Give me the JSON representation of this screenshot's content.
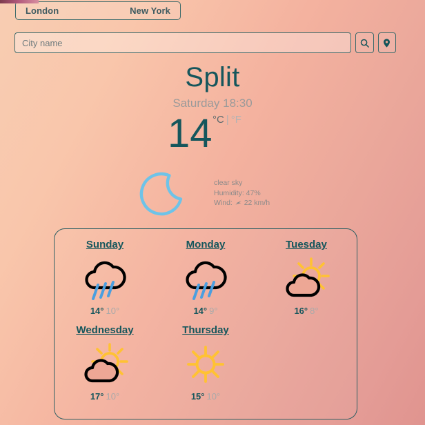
{
  "tabs": [
    {
      "label": "London",
      "name": "tab-london"
    },
    {
      "label": "New York",
      "name": "tab-new-york"
    }
  ],
  "search": {
    "placeholder": "City name",
    "value": "",
    "search_button_icon": "search-icon",
    "location_button_icon": "location-pin-icon"
  },
  "current": {
    "city": "Split",
    "datetime": "Saturday 18:30",
    "temperature": "14",
    "unit_celsius": "°C",
    "unit_separator": "|",
    "unit_fahrenheit": "°F",
    "active_unit": "°C",
    "icon": "crescent-moon-icon",
    "description": "clear sky",
    "humidity": "Humidity: 47%",
    "wind_label": "Wind:",
    "wind_value": "22 km/h",
    "wind_icon": "wind-direction-arrow-icon"
  },
  "forecast": {
    "days": [
      {
        "name": "Sunday",
        "icon": "rain-cloud-icon",
        "high": "14°",
        "low": "10°"
      },
      {
        "name": "Monday",
        "icon": "rain-cloud-icon",
        "high": "14°",
        "low": "9°"
      },
      {
        "name": "Tuesday",
        "icon": "sun-cloud-icon",
        "high": "16°",
        "low": "8°"
      },
      {
        "name": "Wednesday",
        "icon": "sun-cloud-icon",
        "high": "17°",
        "low": "10°"
      },
      {
        "name": "Thursday",
        "icon": "sun-icon",
        "high": "15°",
        "low": "10°"
      }
    ]
  },
  "colors": {
    "accent_dark": "#15565c",
    "muted": "#9a9a9a",
    "sun": "#ffc233",
    "rain": "#4a9fe0",
    "moon": "#6ec3e8",
    "cloud_outline": "#000000",
    "border": "#2c5f63"
  }
}
